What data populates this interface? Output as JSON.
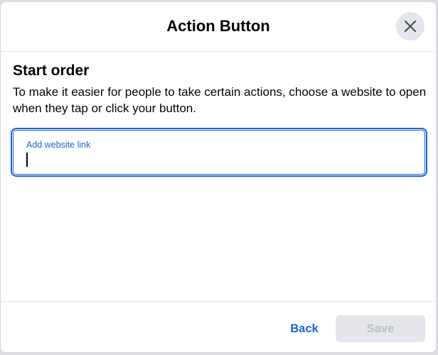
{
  "dialog": {
    "title": "Action Button",
    "close_icon": "close-icon"
  },
  "section": {
    "title": "Start order",
    "description": "To make it easier for people to take certain actions, choose a website to open when they tap or click your button."
  },
  "website_field": {
    "label": "Add website link",
    "value": "",
    "focused": true,
    "accent_color": "#1b64d8"
  },
  "footer": {
    "back_label": "Back",
    "save_label": "Save",
    "save_enabled": false
  },
  "colors": {
    "accent": "#1b64d8",
    "disabled_bg": "#e4e6eb",
    "disabled_text": "#bcc0c4",
    "text": "#050505"
  }
}
